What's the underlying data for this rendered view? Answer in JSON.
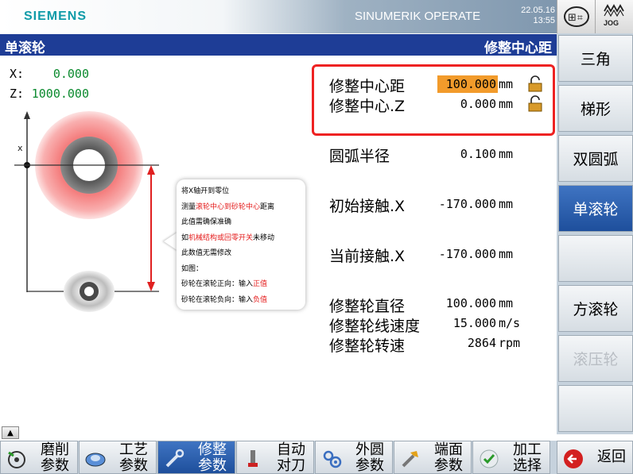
{
  "header": {
    "brand": "SIEMENS",
    "product": "SINUMERIK OPERATE",
    "date": "22.05.16",
    "time": "13:55",
    "jog_label": "JOG"
  },
  "titlebar": {
    "left": "单滚轮",
    "right": "修整中心距"
  },
  "axes": [
    {
      "label": "X:",
      "value": "0.000"
    },
    {
      "label": "Z:",
      "value": "1000.000"
    }
  ],
  "params": {
    "center_dist": {
      "label": "修整中心距",
      "value": "100.000",
      "unit": "mm"
    },
    "center_z": {
      "label": "修整中心.Z",
      "value": "0.000",
      "unit": "mm"
    },
    "arc_radius": {
      "label": "圆弧半径",
      "value": "0.100",
      "unit": "mm"
    },
    "initial_contact": {
      "label": "初始接触.X",
      "value": "-170.000",
      "unit": "mm"
    },
    "current_contact": {
      "label": "当前接触.X",
      "value": "-170.000",
      "unit": "mm"
    },
    "wheel_diameter": {
      "label": "修整轮直径",
      "value": "100.000",
      "unit": "mm"
    },
    "line_speed": {
      "label": "修整轮线速度",
      "value": "15.000",
      "unit": "m/s"
    },
    "spindle_speed": {
      "label": "修整轮转速",
      "value": "2864",
      "unit": "rpm"
    }
  },
  "tooltip": {
    "l1": "将X轴开到零位",
    "l2a": "测量",
    "l2b": "滚轮中心到砂轮中心",
    "l2c": "距离",
    "l3": "此值需确保准确",
    "l4a": "如",
    "l4b": "机械结构或回零开关",
    "l4c": "未移动",
    "l5": "此数值无需修改",
    "l6": "如图：",
    "l7a": "砂轮在滚轮正向：输入",
    "l7b": "正值",
    "l8a": "砂轮在滚轮负向：输入",
    "l8b": "负值"
  },
  "right_softkeys": [
    "三角",
    "梯形",
    "双圆弧",
    "单滚轮",
    "",
    "方滚轮",
    "滚压轮",
    ""
  ],
  "bottom_softkeys": [
    {
      "l1": "磨削",
      "l2": "参数",
      "icon": "grinding-icon"
    },
    {
      "l1": "工艺",
      "l2": "参数",
      "icon": "process-icon"
    },
    {
      "l1": "修整",
      "l2": "参数",
      "icon": "dressing-icon"
    },
    {
      "l1": "自动",
      "l2": "对刀",
      "icon": "touch-probe-icon"
    },
    {
      "l1": "外圆",
      "l2": "参数",
      "icon": "external-round-icon"
    },
    {
      "l1": "端面",
      "l2": "参数",
      "icon": "face-icon"
    },
    {
      "l1": "加工",
      "l2": "选择",
      "icon": "check-icon"
    },
    {
      "l1": "返回",
      "icon": "back-icon"
    }
  ],
  "colors": {
    "title_blue": "#1e3d96",
    "active_field": "#f29b2b",
    "highlight_red": "#ee2222",
    "axis_value_green": "#0b8a2e"
  }
}
